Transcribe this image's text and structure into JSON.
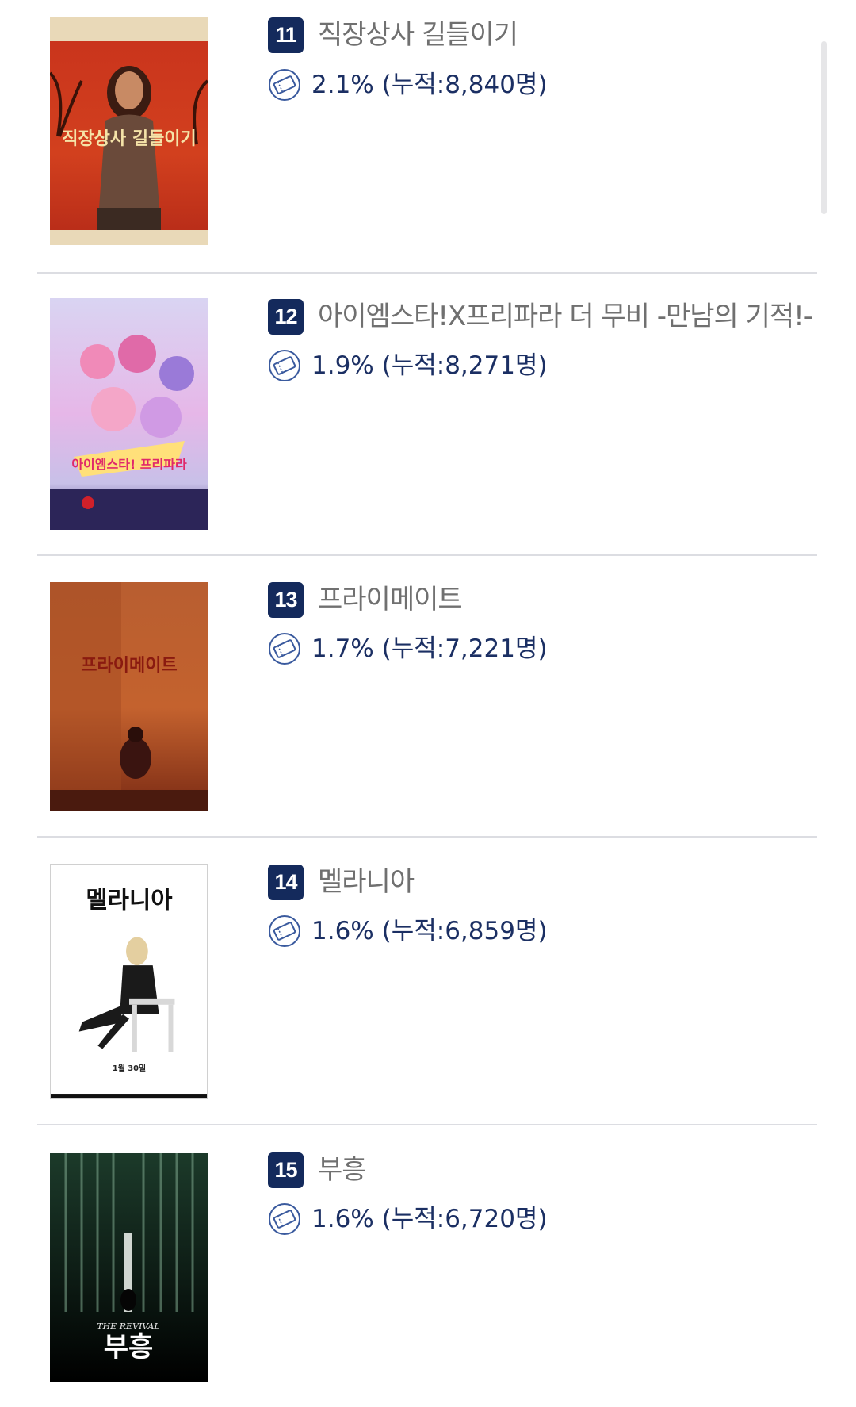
{
  "colors": {
    "badge": "#142a5c",
    "title": "#707070",
    "share": "#1b2f63",
    "divider": "#dcdde2",
    "icon": "#3a5a9e"
  },
  "icons": {
    "ticket": "ticket-icon"
  },
  "movies": [
    {
      "rank": "11",
      "title": "직장상사 길들이기",
      "share": "2.1% (누적:8,840명)",
      "poster_text": "직장상사 길들이기"
    },
    {
      "rank": "12",
      "title": "아이엠스타!X프리파라 더 무비 -만남의 기적!-",
      "share": "1.9% (누적:8,271명)",
      "poster_text": "아이엠스타! 프리파라"
    },
    {
      "rank": "13",
      "title": "프라이메이트",
      "share": "1.7% (누적:7,221명)",
      "poster_text": "프라이메이트"
    },
    {
      "rank": "14",
      "title": "멜라니아",
      "share": "1.6% (누적:6,859명)",
      "poster_text": "멜라니아",
      "poster_date": "1월 30일"
    },
    {
      "rank": "15",
      "title": "부흥",
      "share": "1.6% (누적:6,720명)",
      "poster_text": "부흥",
      "poster_subtitle": "THE REVIVAL"
    }
  ]
}
